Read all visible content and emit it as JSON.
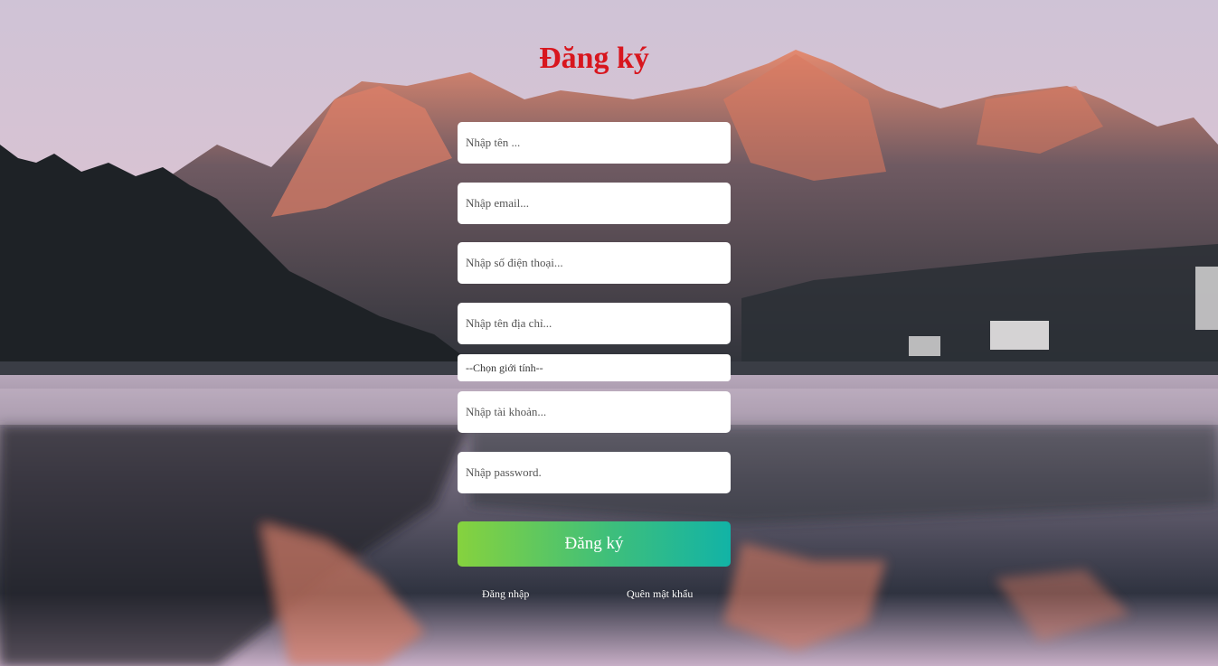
{
  "form": {
    "title": "Đăng ký",
    "fields": {
      "name": {
        "placeholder": "Nhập tên ...",
        "value": ""
      },
      "email": {
        "placeholder": "Nhập email...",
        "value": ""
      },
      "phone": {
        "placeholder": "Nhập số điện thoại...",
        "value": ""
      },
      "address": {
        "placeholder": "Nhập tên địa chỉ...",
        "value": ""
      },
      "username": {
        "placeholder": "Nhập tài khoản...",
        "value": ""
      },
      "password": {
        "placeholder": "Nhập password.",
        "value": ""
      }
    },
    "gender_select": {
      "selected": "--Chọn giới tính--"
    },
    "submit_label": "Đăng ký",
    "links": {
      "login": "Đăng nhập",
      "forgot_password": "Quên mật khẩu"
    }
  },
  "colors": {
    "title": "#d8161e",
    "button_gradient_start": "#86d23e",
    "button_gradient_end": "#12b3a6",
    "link": "#ffffff"
  }
}
